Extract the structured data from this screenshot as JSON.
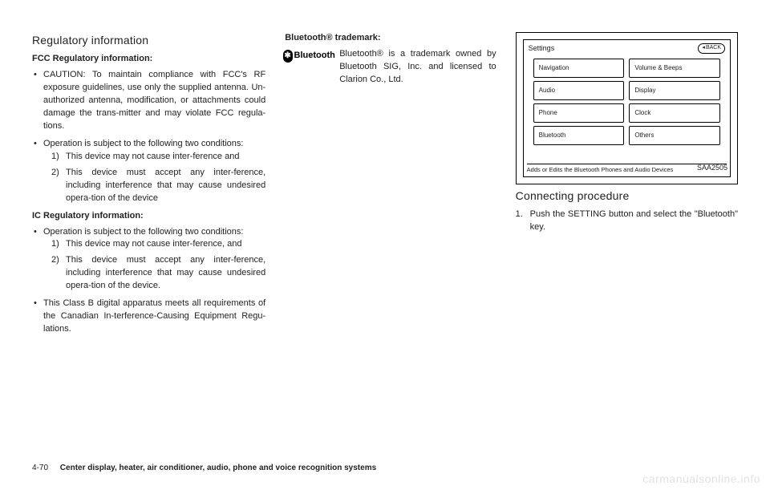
{
  "col1": {
    "heading": "Regulatory information",
    "fcc_title": "FCC Regulatory information:",
    "fcc_bullets": [
      "CAUTION: To maintain compliance with FCC's RF exposure guidelines, use only the supplied antenna. Un-authorized antenna, modification, or attachments could damage the trans-mitter and may violate FCC regula-tions.",
      "Operation is subject to the following two conditions:"
    ],
    "fcc_sub": [
      "This device may not cause inter-ference and",
      "This device must accept any inter-ference, including interference that may cause undesired opera-tion of the device"
    ],
    "ic_title": "IC Regulatory information:",
    "ic_bullets_1": "Operation is subject to the following two conditions:",
    "ic_sub": [
      "This device may not cause inter-ference, and",
      "This device must accept any inter-ference, including interference that may cause undesired opera-tion of the device."
    ],
    "ic_bullets_2": "This Class B digital apparatus meets all requirements of the Canadian In-terference-Causing Equipment Regu-lations."
  },
  "col2": {
    "bt_title": "Bluetooth® trademark:",
    "bt_logo_text": "Bluetooth",
    "bt_text": "Bluetooth® is a trademark owned by Bluetooth SIG, Inc. and licensed to Clarion Co., Ltd."
  },
  "col3": {
    "screen": {
      "title": "Settings",
      "back": "BACK",
      "cells": [
        "Navigation",
        "Volume & Beeps",
        "Audio",
        "Display",
        "Phone",
        "Clock",
        "Bluetooth",
        "Others"
      ],
      "footer": "Adds or Edits the Bluetooth Phones and Audio Devices",
      "caption": "SAA2505"
    },
    "conn_heading": "Connecting procedure",
    "conn_step1": "Push the SETTING button and select the \"Bluetooth\" key."
  },
  "footer": {
    "page": "4-70",
    "chapter": "Center display, heater, air conditioner, audio, phone and voice recognition systems"
  },
  "watermark": "carmanualsonline.info"
}
